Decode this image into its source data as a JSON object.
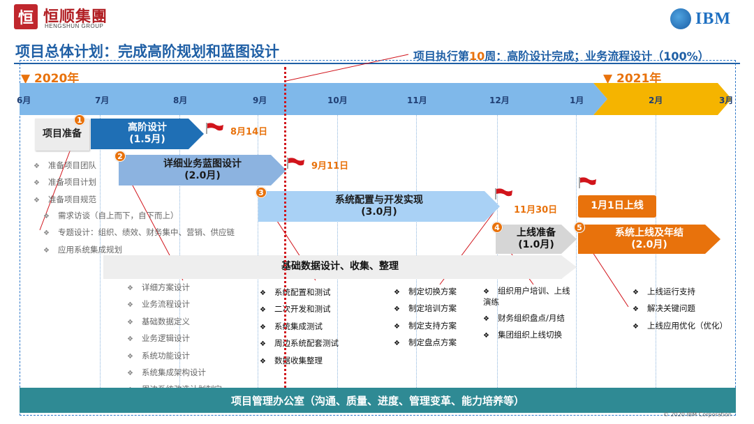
{
  "header": {
    "logo_glyph": "恒",
    "company_cn": "恒顺集團",
    "company_en": "HENGSHUN GROUP",
    "partner_logo": "IBM"
  },
  "title": "项目总体计划：完成高阶规划和蓝图设计",
  "week_note": {
    "prefix": "项目执行第",
    "week": "10",
    "suffix": "周：高阶设计完成；业务流程设计（100%）"
  },
  "years": {
    "start": "▼ 2020年",
    "next": "▼ 2021年"
  },
  "months": [
    "6月",
    "7月",
    "8月",
    "9月",
    "10月",
    "11月",
    "12月",
    "1月",
    "2月",
    "3月"
  ],
  "colors": {
    "accent_blue": "#1f5fa5",
    "orange": "#e8720c",
    "timeline_blue": "#7fb8ea",
    "timeline_gold": "#f5b400",
    "pmo_teal": "#2f8a94",
    "milestone_red": "#d1141b"
  },
  "phases": {
    "prep": "项目准备",
    "high_level": {
      "title": "高阶设计",
      "duration": "(1.5月)",
      "date": "8月14日",
      "step": "1"
    },
    "blueprint": {
      "title": "详细业务蓝图设计",
      "duration": "(2.0月)",
      "date": "9月11日",
      "step": "2"
    },
    "build": {
      "title": "系统配置与开发实现",
      "duration": "(3.0月)",
      "date": "11月30日",
      "step": "3"
    },
    "golive_prep": {
      "title": "上线准备",
      "duration": "(1.0月)",
      "step": "4"
    },
    "golive_date": "1月1日上线",
    "golive": {
      "title": "系统上线及年结",
      "duration": "(2.0月)",
      "step": "5"
    },
    "master_data": "基础数据设计、收集、整理",
    "pmo": "项目管理办公室（沟通、质量、进度、管理变革、能力培养等）"
  },
  "lists": {
    "prep_items": [
      "准备项目团队",
      "准备项目计划",
      "准备项目规范"
    ],
    "high_level_items": [
      "需求访谈（自上而下，自下而上）",
      "专题设计：组织、绩效、财务集中、营销、供应链",
      "应用系统集成规划"
    ],
    "blueprint_items": [
      "详细方案设计",
      "业务流程设计",
      "基础数据定义",
      "业务逻辑设计",
      "系统功能设计",
      "系统集成架构设计",
      "周边系统改造计划制定"
    ],
    "build_items": [
      "系统配置和测试",
      "二次开发和测试",
      "系统集成测试",
      "周边系统配套测试",
      "数据收集整理"
    ],
    "build_plan_items": [
      "制定切换方案",
      "制定培训方案",
      "制定支持方案",
      "制定盘点方案"
    ],
    "golive_prep_items": [
      "组织用户培训、上线演练",
      "财务组织盘点/月结",
      "集团组织上线切换"
    ],
    "golive_items": [
      "上线运行支持",
      "解决关键问题",
      "上线应用优化（优化）"
    ]
  },
  "footer": "© 2020 IBM Corporation"
}
